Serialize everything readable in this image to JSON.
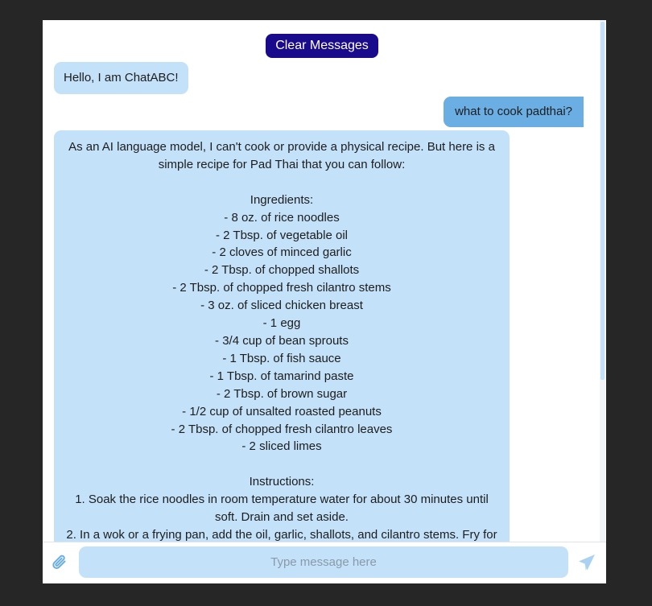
{
  "header": {
    "clear_label": "Clear Messages"
  },
  "messages": [
    {
      "role": "bot",
      "text": "Hello, I am ChatABC!"
    },
    {
      "role": "user",
      "text": "what to cook padthai?"
    },
    {
      "role": "bot",
      "text": "As an AI language model, I can't cook or provide a physical recipe. But here is a simple recipe for Pad Thai that you can follow:\n\nIngredients:\n- 8 oz. of rice noodles\n- 2 Tbsp. of vegetable oil\n- 2 cloves of minced garlic\n- 2 Tbsp. of chopped shallots\n- 2 Tbsp. of chopped fresh cilantro stems\n- 3 oz. of sliced chicken breast\n- 1 egg\n- 3/4 cup of bean sprouts\n- 1 Tbsp. of fish sauce\n- 1 Tbsp. of tamarind paste\n- 2 Tbsp. of brown sugar\n- 1/2 cup of unsalted roasted peanuts\n- 2 Tbsp. of chopped fresh cilantro leaves\n- 2 sliced limes\n\nInstructions:\n1. Soak the rice noodles in room temperature water for about 30 minutes until soft. Drain and set aside.\n2. In a wok or a frying pan, add the oil, garlic, shallots, and cilantro stems. Fry for a"
    }
  ],
  "composer": {
    "placeholder": "Type message here",
    "value": ""
  },
  "icons": {
    "attach": "paperclip-icon",
    "send": "paper-plane-icon"
  },
  "colors": {
    "page_background": "#262626",
    "window_background": "#ffffff",
    "clear_button": "#1a0b8c",
    "bot_bubble": "#c3e1f8",
    "user_bubble": "#6aaee3",
    "icon": "#6aaee3"
  }
}
